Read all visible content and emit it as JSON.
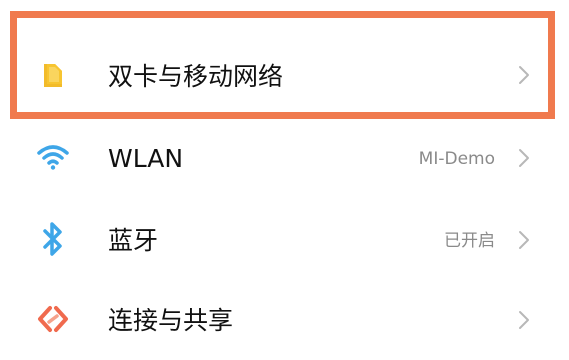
{
  "settings": {
    "items": [
      {
        "label": "双卡与移动网络",
        "value": "",
        "icon": "sim-card-icon",
        "icon_color": "#f7c531"
      },
      {
        "label": "WLAN",
        "value": "MI-Demo",
        "icon": "wifi-icon",
        "icon_color": "#3ea6e8"
      },
      {
        "label": "蓝牙",
        "value": "已开启",
        "icon": "bluetooth-icon",
        "icon_color": "#3ea6e8"
      },
      {
        "label": "连接与共享",
        "value": "",
        "icon": "connection-share-icon",
        "icon_color": "#f06a4e"
      }
    ]
  },
  "highlight": {
    "color": "#f07a4e",
    "target": "双卡与移动网络"
  },
  "colors": {
    "chevron": "#b8b8b8",
    "label_text": "#111111",
    "value_text": "#8a8a8a"
  }
}
